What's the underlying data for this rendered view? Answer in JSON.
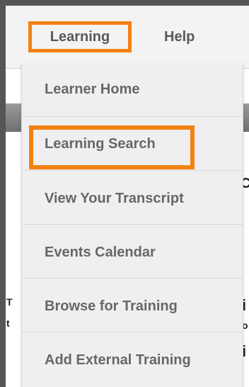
{
  "top_nav": {
    "learning_label": "Learning",
    "help_label": "Help"
  },
  "dropdown": {
    "items": [
      {
        "label": "Learner Home"
      },
      {
        "label": "Learning Search"
      },
      {
        "label": "View Your Transcript"
      },
      {
        "label": "Events Calendar"
      },
      {
        "label": "Browse for Training"
      },
      {
        "label": "Add External Training"
      }
    ]
  },
  "background_fragments": {
    "frag_1": "C",
    "frag_2": "i",
    "frag_3": "o",
    "frag_4": "i",
    "frag_5": "T",
    "frag_6": "t"
  },
  "colors": {
    "highlight": "#f38112",
    "menu_text": "#676767",
    "menu_bg": "#efefef"
  }
}
